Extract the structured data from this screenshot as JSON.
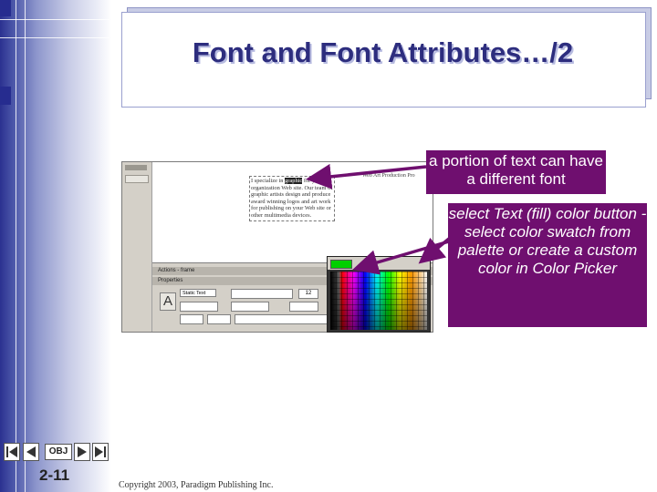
{
  "slide": {
    "title": "Font and Font Attributes…/2",
    "page_number": "2-11",
    "copyright": "Copyright 2003, Paradigm Publishing Inc."
  },
  "nav": {
    "obj_label": "OBJ"
  },
  "callouts": {
    "portion_text": "a portion of text can have a different font",
    "color_text": "select Text (fill) color button -select color swatch from palette or create a custom color in Color Picker"
  },
  "screenshot": {
    "panel_actions": "Actions - frame",
    "panel_properties": "Properties",
    "text_type": "Static Text",
    "size_value": "12",
    "heading": "Web Art Production Pro"
  },
  "colors": {
    "callout_bg": "#6f0f6f",
    "title_color": "#2d2d7e",
    "sidebar_accent": "#262c8f",
    "selected_swatch": "#00d000"
  }
}
